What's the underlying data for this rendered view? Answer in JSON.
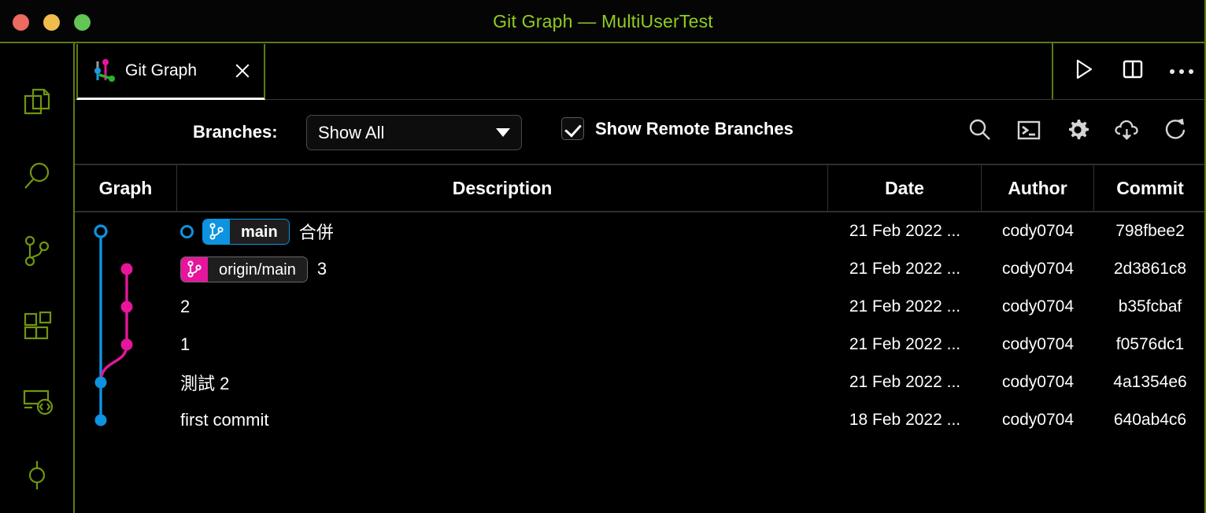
{
  "window": {
    "title": "Git Graph — MultiUserTest",
    "title_color": "#8fcc23",
    "traffic_lights": [
      "close-button",
      "minimize-button",
      "maximize-button"
    ]
  },
  "activitybar": {
    "items": [
      {
        "name": "explorer",
        "icon": "files-icon"
      },
      {
        "name": "search",
        "icon": "search-icon"
      },
      {
        "name": "source-control",
        "icon": "source-control-icon"
      },
      {
        "name": "extensions",
        "icon": "extensions-icon"
      },
      {
        "name": "remote-explorer",
        "icon": "remote-explorer-icon"
      },
      {
        "name": "git-graph",
        "icon": "git-commit-icon"
      }
    ]
  },
  "tabbar": {
    "tab_label": "Git Graph",
    "tab_icon": "git-graph-icon",
    "close_icon": "close-icon",
    "actions": [
      {
        "name": "run-button",
        "icon": "play-icon"
      },
      {
        "name": "split-editor-button",
        "icon": "split-editor-icon"
      },
      {
        "name": "more-actions-button",
        "icon": "ellipsis-icon"
      }
    ]
  },
  "toolbar": {
    "branches_label": "Branches:",
    "branch_select_value": "Show All",
    "branch_select_options": [
      "Show All"
    ],
    "show_remote_branches_label": "Show Remote Branches",
    "show_remote_branches_checked": true,
    "actions": [
      {
        "name": "search-button",
        "icon": "search-icon"
      },
      {
        "name": "terminal-button",
        "icon": "terminal-icon"
      },
      {
        "name": "settings-button",
        "icon": "gear-icon"
      },
      {
        "name": "fetch-button",
        "icon": "cloud-download-icon"
      },
      {
        "name": "refresh-button",
        "icon": "refresh-icon"
      }
    ]
  },
  "table": {
    "headers": {
      "graph": "Graph",
      "description": "Description",
      "date": "Date",
      "author": "Author",
      "commit": "Commit"
    },
    "rows": [
      {
        "message": "合併",
        "date": "21 Feb 2022 ...",
        "author": "cody0704",
        "commit": "798fbee2",
        "head": true,
        "refs": [
          {
            "label": "main",
            "type": "local",
            "color": "#0d93e0"
          }
        ]
      },
      {
        "message": "3",
        "date": "21 Feb 2022 ...",
        "author": "cody0704",
        "commit": "2d3861c8",
        "head": false,
        "refs": [
          {
            "label": "origin/main",
            "type": "remote",
            "color": "#e6159b"
          }
        ]
      },
      {
        "message": "2",
        "date": "21 Feb 2022 ...",
        "author": "cody0704",
        "commit": "b35fcbaf",
        "head": false,
        "refs": []
      },
      {
        "message": "1",
        "date": "21 Feb 2022 ...",
        "author": "cody0704",
        "commit": "f0576dc1",
        "head": false,
        "refs": []
      },
      {
        "message": "測試 2",
        "date": "21 Feb 2022 ...",
        "author": "cody0704",
        "commit": "4a1354e6",
        "head": false,
        "refs": []
      },
      {
        "message": "first commit",
        "date": "18 Feb 2022 ...",
        "author": "cody0704",
        "commit": "640ab4c6",
        "head": false,
        "refs": []
      }
    ]
  },
  "graph": {
    "colors": {
      "branch_blue": "#0d93e0",
      "branch_pink": "#e6159b"
    },
    "nodes": [
      {
        "row": 0,
        "lane": 0,
        "color": "#0d93e0",
        "filled": false
      },
      {
        "row": 1,
        "lane": 1,
        "color": "#e6159b",
        "filled": true
      },
      {
        "row": 2,
        "lane": 1,
        "color": "#e6159b",
        "filled": true
      },
      {
        "row": 3,
        "lane": 1,
        "color": "#e6159b",
        "filled": true
      },
      {
        "row": 4,
        "lane": 0,
        "color": "#0d93e0",
        "filled": true
      },
      {
        "row": 5,
        "lane": 0,
        "color": "#0d93e0",
        "filled": true
      }
    ]
  }
}
